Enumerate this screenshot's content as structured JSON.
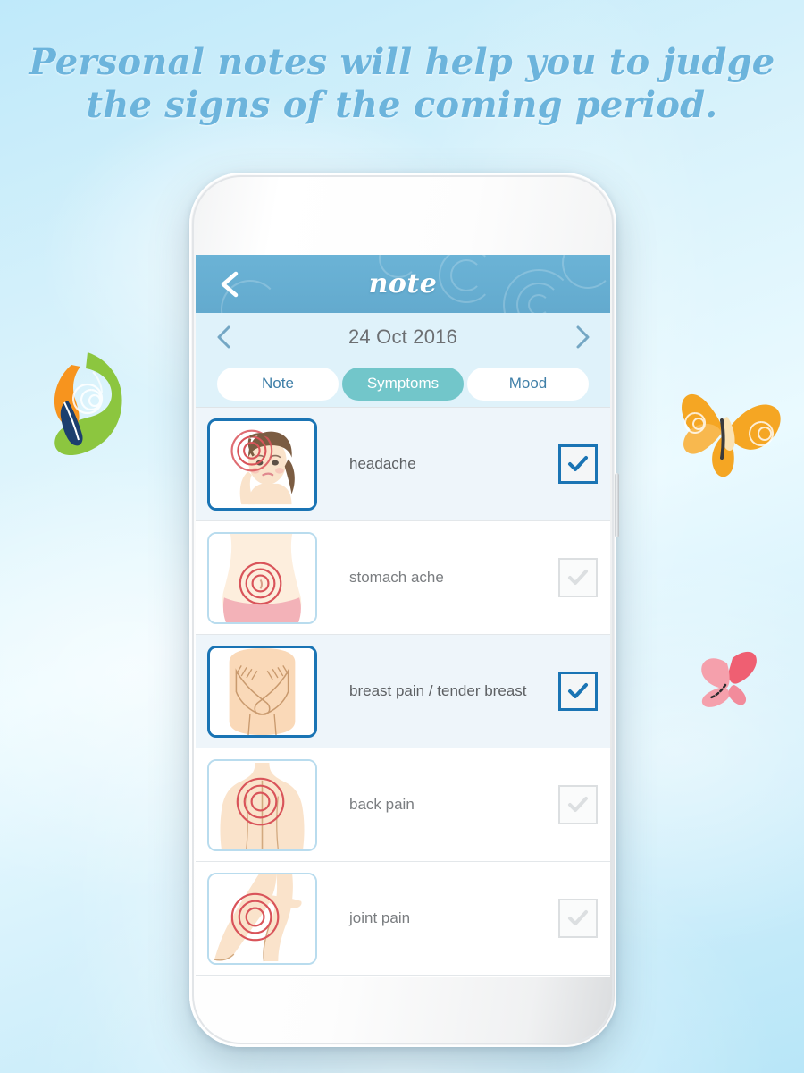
{
  "headline": {
    "line1": "Personal notes will help you to judge",
    "line2": "the signs of the coming period.",
    "color": "#6cb4dc"
  },
  "app": {
    "title": "note",
    "header_color": "#67b0d2",
    "back_icon": "back-chevron-icon"
  },
  "date_nav": {
    "prev_icon": "chevron-left-icon",
    "next_icon": "chevron-right-icon",
    "date": "24 Oct 2016"
  },
  "tabs": [
    {
      "label": "Note",
      "active": false
    },
    {
      "label": "Symptoms",
      "active": true
    },
    {
      "label": "Mood",
      "active": false
    }
  ],
  "symptoms": [
    {
      "label": "headache",
      "checked": true,
      "icon": "headache-illustration"
    },
    {
      "label": "stomach ache",
      "checked": false,
      "icon": "stomach-ache-illustration"
    },
    {
      "label": "breast pain / tender breast",
      "checked": true,
      "icon": "breast-pain-illustration"
    },
    {
      "label": "back pain",
      "checked": false,
      "icon": "back-pain-illustration"
    },
    {
      "label": "joint pain",
      "checked": false,
      "icon": "joint-pain-illustration"
    }
  ],
  "colors": {
    "accent_blue": "#1a74b4",
    "tab_active": "#72c6ca",
    "tab_text": "#3f7fa8",
    "date_bar": "#dff2fa",
    "pain_ring": "#d9545a",
    "skin": "#fae3cb"
  },
  "decorations": [
    {
      "name": "butterfly-green",
      "colors": [
        "#8cc63f",
        "#f7941e"
      ]
    },
    {
      "name": "butterfly-orange",
      "colors": [
        "#f5a623",
        "#fbd38a"
      ]
    },
    {
      "name": "butterfly-pink",
      "colors": [
        "#f28b9b",
        "#f9c6cf"
      ]
    }
  ]
}
